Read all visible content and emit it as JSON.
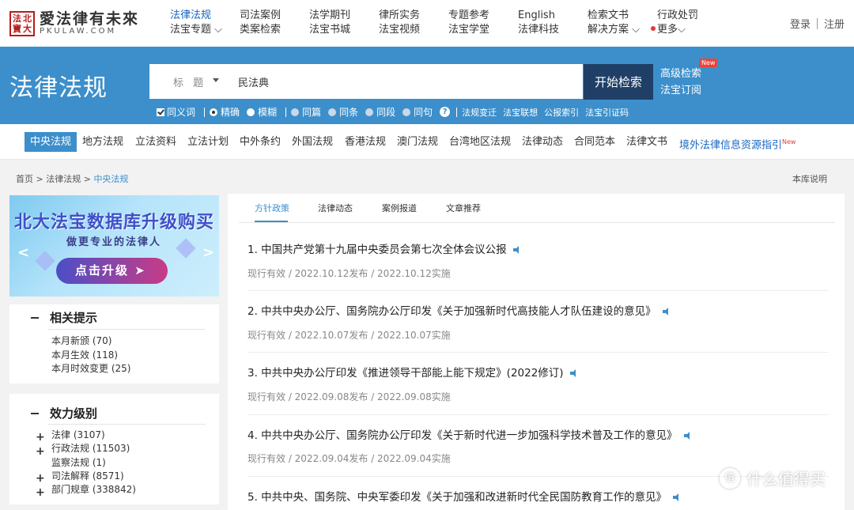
{
  "logo": {
    "seal": [
      "法",
      "北",
      "寶",
      "大"
    ],
    "cn": "愛法律有未來",
    "en": "PKULAW.COM"
  },
  "nav": {
    "columns": [
      [
        "法律法规",
        "法宝专题"
      ],
      [
        "司法案例",
        "类案检索"
      ],
      [
        "法学期刊",
        "法宝书城"
      ],
      [
        "律所实务",
        "法宝视频"
      ],
      [
        "专题参考",
        "法宝学堂"
      ],
      [
        "English",
        "法律科技"
      ],
      [
        "检索文书",
        "解决方案"
      ],
      [
        "行政处罚",
        "更多"
      ]
    ],
    "login": "登录",
    "register": "注册"
  },
  "band": {
    "title": "法律法规",
    "field": "标 题",
    "query": "民法典",
    "search_btn": "开始检索",
    "advanced": "高级检索",
    "subscribe": "法宝订阅",
    "new_badge": "New",
    "options": {
      "synonym": "同义词",
      "exact": "精确",
      "fuzzy": "模糊",
      "same_doc": "同篇",
      "same_article": "同条",
      "same_para": "同段",
      "same_sentence": "同句",
      "help": "?",
      "links": [
        "法规变迁",
        "法宝联想",
        "公报索引",
        "法宝引证码"
      ]
    }
  },
  "categories": [
    "中央法规",
    "地方法规",
    "立法资料",
    "立法计划",
    "中外条约",
    "外国法规",
    "香港法规",
    "澳门法规",
    "台湾地区法规",
    "法律动态",
    "合同范本",
    "法律文书",
    "境外法律信息资源指引"
  ],
  "category_new": "New",
  "breadcrumb": {
    "home": "首页",
    "sep": ">",
    "level1": "法律法规",
    "current": "中央法规",
    "note": "本库说明"
  },
  "banner": {
    "title": "北大法宝数据库升级购买",
    "subtitle": "做更专业的法律人",
    "button": "点击升级",
    "left": "<",
    "right": ">"
  },
  "hints": {
    "title": "相关提示",
    "items": [
      "本月新颁 (70)",
      "本月生效 (118)",
      "本月时效变更 (25)"
    ]
  },
  "levels": {
    "title": "效力级别",
    "items": [
      "法律 (3107)",
      "行政法规 (11503)",
      "监察法规 (1)",
      "司法解释 (8571)",
      "部门规章 (338842)"
    ]
  },
  "tabs": [
    "方针政策",
    "法律动态",
    "案例报道",
    "文章推荐"
  ],
  "items": [
    {
      "title": "1. 中国共产党第十九届中央委员会第七次全体会议公报",
      "meta": "现行有效 / 2022.10.12发布 / 2022.10.12实施"
    },
    {
      "title": "2. 中共中央办公厅、国务院办公厅印发《关于加强新时代高技能人才队伍建设的意见》",
      "meta": "现行有效 / 2022.10.07发布 / 2022.10.07实施"
    },
    {
      "title": "3. 中共中央办公厅印发《推进领导干部能上能下规定》(2022修订)",
      "meta": "现行有效 / 2022.09.08发布 / 2022.09.08实施"
    },
    {
      "title": "4. 中共中央办公厅、国务院办公厅印发《关于新时代进一步加强科学技术普及工作的意见》",
      "meta": "现行有效 / 2022.09.04发布 / 2022.09.04实施"
    },
    {
      "title": "5. 中共中央、国务院、中央军委印发《关于加强和改进新时代全民国防教育工作的意见》",
      "meta": ""
    }
  ],
  "watermark": {
    "icon": "值",
    "text": "什么值得买"
  }
}
